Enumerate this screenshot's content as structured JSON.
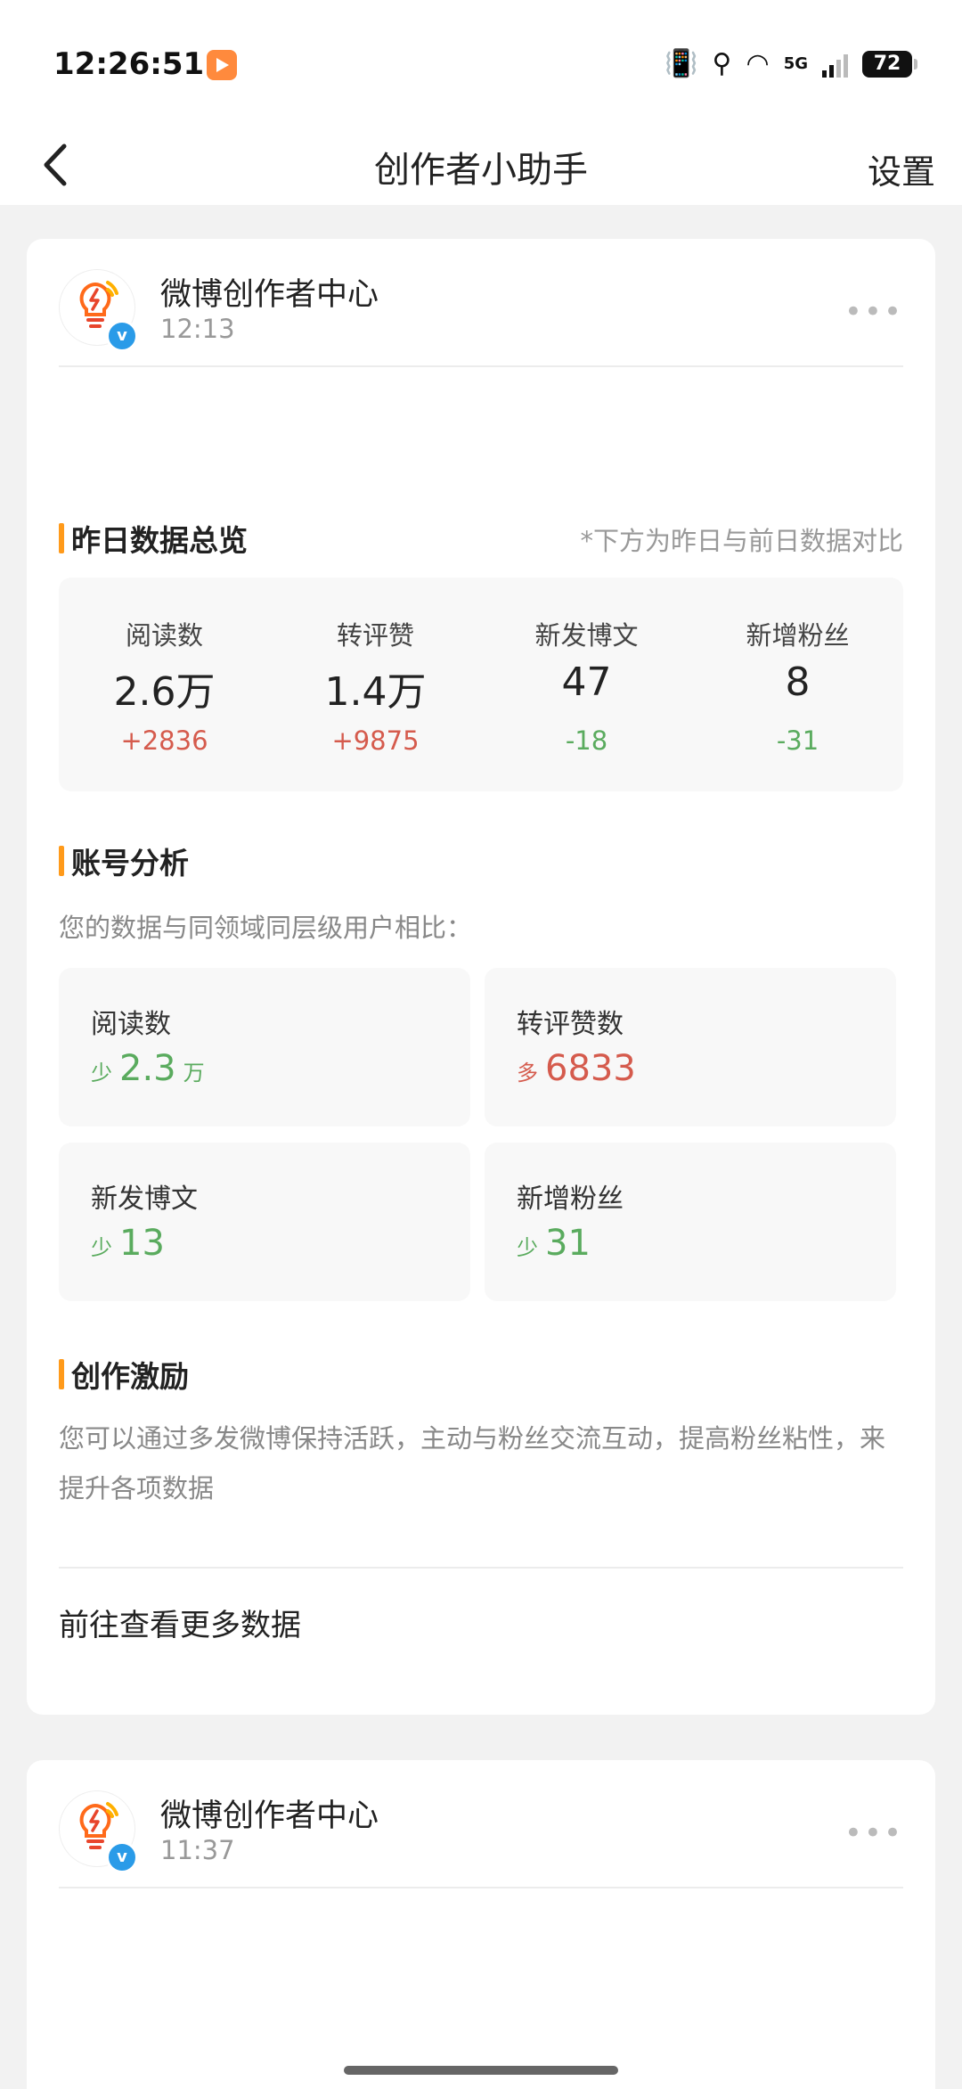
{
  "status_bar": {
    "time": "12:26:51",
    "network": "5G",
    "battery": "72"
  },
  "nav": {
    "title": "创作者小助手",
    "settings": "设置"
  },
  "messages": [
    {
      "sender": "微博创作者中心",
      "time": "12:13"
    },
    {
      "sender": "微博创作者中心",
      "time": "11:37"
    }
  ],
  "overview": {
    "title": "昨日数据总览",
    "note": "*下方为昨日与前日数据对比",
    "stats": [
      {
        "label": "阅读数",
        "value": "2.6万",
        "delta": "+2836",
        "trend": "up"
      },
      {
        "label": "转评赞",
        "value": "1.4万",
        "delta": "+9875",
        "trend": "up"
      },
      {
        "label": "新发博文",
        "value": "47",
        "delta": "-18",
        "trend": "down"
      },
      {
        "label": "新增粉丝",
        "value": "8",
        "delta": "-31",
        "trend": "down"
      }
    ]
  },
  "analysis": {
    "title": "账号分析",
    "subtitle": "您的数据与同领域同层级用户相比：",
    "cells": [
      {
        "label": "阅读数",
        "direction": "少",
        "value": "2.3",
        "unit": "万",
        "trend": "down"
      },
      {
        "label": "转评赞数",
        "direction": "多",
        "value": "6833",
        "unit": "",
        "trend": "up"
      },
      {
        "label": "新发博文",
        "direction": "少",
        "value": "13",
        "unit": "",
        "trend": "down"
      },
      {
        "label": "新增粉丝",
        "direction": "少",
        "value": "31",
        "unit": "",
        "trend": "down"
      }
    ]
  },
  "incentive": {
    "title": "创作激励",
    "text": "您可以通过多发微博保持活跃，主动与粉丝交流互动，提高粉丝粘性，来提升各项数据"
  },
  "more_data_link": "前往查看更多数据",
  "colors": {
    "accent_bar": "#ff9a1a",
    "up": "#d55b4d",
    "down": "#5aab5e",
    "verified": "#2a9be8"
  }
}
